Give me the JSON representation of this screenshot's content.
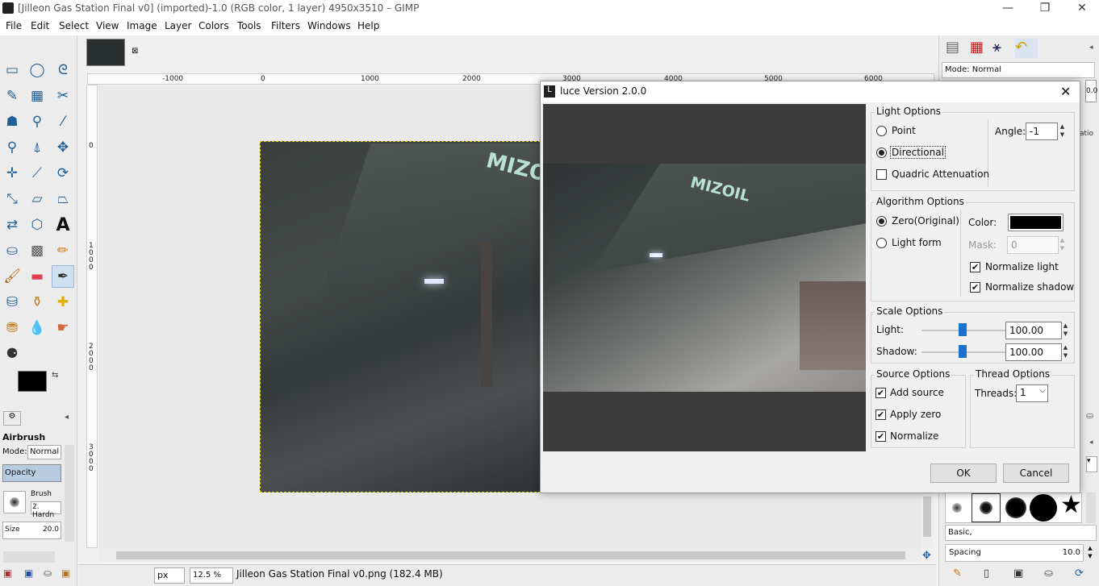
{
  "window": {
    "title": "[Jilleon Gas Station Final v0] (imported)-1.0 (RGB color, 1 layer) 4950x3510 – GIMP",
    "minimize": "—",
    "maximize": "❐",
    "close": "✕"
  },
  "menu": [
    "File",
    "Edit",
    "Select",
    "View",
    "Image",
    "Layer",
    "Colors",
    "Tools",
    "Filters",
    "Windows",
    "Help"
  ],
  "ruler_top": [
    "-1000",
    "0",
    "1000",
    "2000",
    "3000",
    "4000",
    "5000",
    "6000"
  ],
  "ruler_left": [
    "0",
    "1\n0\n0\n0",
    "2\n0\n0\n0",
    "3\n0\n0\n0"
  ],
  "tool_options": {
    "title": "Airbrush",
    "mode_label": "Mode:",
    "mode_value": "Normal",
    "opacity_label": "Opacity",
    "brush_label": "Brush",
    "brush_value": "2. Hardn",
    "size_label": "Size",
    "size_value": "20.0"
  },
  "right_panel": {
    "mode_label": "Mode: Normal",
    "brush_set": "Basic,",
    "spacing_label": "Spacing",
    "spacing_value": "10.0",
    "partial_value": "0.0",
    "partial_label": "atio"
  },
  "status": {
    "unit": "px",
    "zoom": "12.5 %",
    "message": "Jilleon Gas Station Final v0.png (182.4 MB)"
  },
  "image_sign": "MIZO",
  "dialog": {
    "title": "luce Version 2.0.0",
    "preview_sign": "MIZOIL",
    "light_options": {
      "label": "Light Options",
      "point": "Point",
      "directional": "Directional",
      "quadric": "Quadric Attenuation",
      "angle_label": "Angle:",
      "angle_value": "-1"
    },
    "algorithm_options": {
      "label": "Algorithm Options",
      "zero": "Zero(Original)",
      "light_form": "Light form",
      "color_label": "Color:",
      "color_value": "#000000",
      "mask_label": "Mask:",
      "mask_value": "0",
      "normalize_light": "Normalize light",
      "normalize_shadow": "Normalize shadow"
    },
    "scale_options": {
      "label": "Scale Options",
      "light_label": "Light:",
      "light_value": "100.00",
      "shadow_label": "Shadow:",
      "shadow_value": "100.00"
    },
    "source_options": {
      "label": "Source Options",
      "add_source": "Add source",
      "apply_zero": "Apply zero",
      "normalize": "Normalize"
    },
    "thread_options": {
      "label": "Thread Options",
      "threads_label": "Threads:",
      "threads_value": "1"
    },
    "ok": "OK",
    "cancel": "Cancel"
  }
}
